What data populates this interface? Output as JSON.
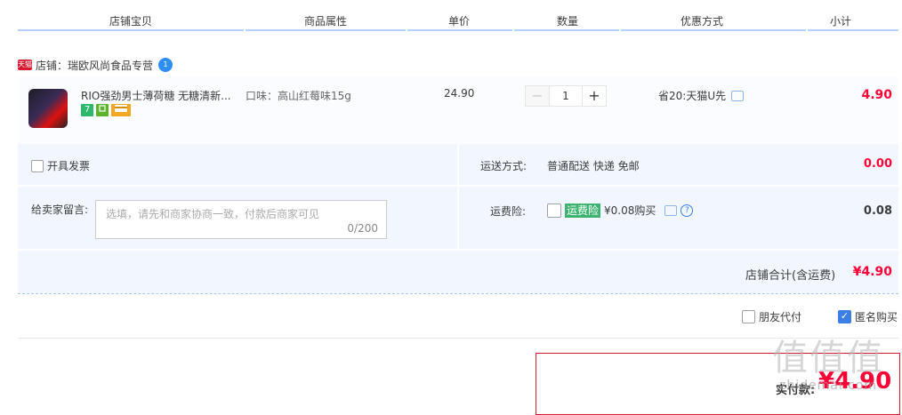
{
  "header": {
    "columns": [
      "店铺宝贝",
      "商品属性",
      "单价",
      "数量",
      "优惠方式",
      "小计"
    ]
  },
  "shop": {
    "badge": "天猫",
    "name": "店铺：瑞欧风尚食品专营",
    "ww_badge": "1"
  },
  "item": {
    "title": "RIO强劲男士薄荷糖 无糖清新...",
    "badges": [
      "7",
      "",
      ""
    ],
    "attribute": "口味：高山红莓味15g",
    "unit_price": "24.90",
    "quantity": "1",
    "minus": "−",
    "plus": "+",
    "promo": "省20:天猫U先",
    "subtotal": "4.90"
  },
  "invoice": {
    "label": "开具发票"
  },
  "shipping": {
    "label": "运送方式:",
    "value": "普通配送 快递 免邮",
    "amount": "0.00"
  },
  "message": {
    "label": "给卖家留言:",
    "placeholder": "选填，请先和商家协商一致，付款后商家可见",
    "counter": "0/200"
  },
  "insurance": {
    "label": "运费险:",
    "tag": "运费险",
    "price_text": "¥0.08购买",
    "help": "?",
    "amount": "0.08"
  },
  "shop_total": {
    "label": "店铺合计(含运费)",
    "amount": "¥4.90"
  },
  "options": {
    "friend_pay": "朋友代付",
    "anonymous": "匿名购买",
    "anonymous_checked_mark": "✓"
  },
  "pay": {
    "label": "实付款:",
    "amount": "¥4.90"
  },
  "watermark": {
    "main": "值值值",
    "sub": "zhidemai.com"
  },
  "colors": {
    "accent_red": "#ff0036",
    "tmall_red": "#d8192f",
    "band_blue": "#f2f7ff",
    "header_line": "#b2d1ff",
    "checkbox_blue": "#3a7ee6"
  }
}
